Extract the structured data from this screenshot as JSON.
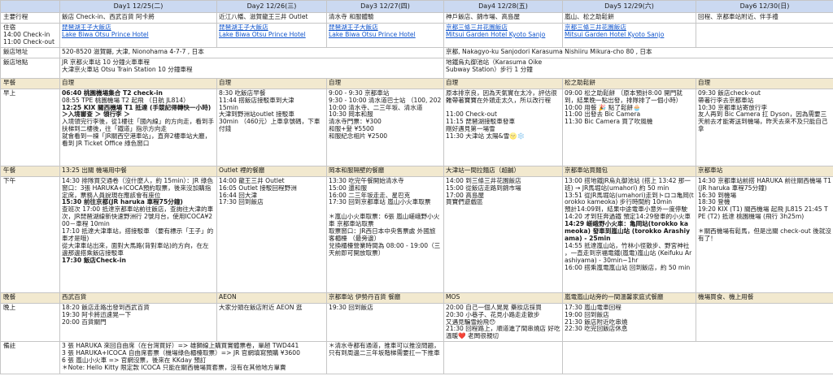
{
  "columns": [
    "Day1 12/25(二)",
    "Day2 12/26(三)",
    "Day3 12/27(四)",
    "Day4 12/28(五)",
    "Day5 12/29(六)",
    "Day6 12/30(日)"
  ],
  "rows": [
    {
      "label": [
        "主要行程"
      ],
      "band": false,
      "cells": [
        [
          {
            "t": "飯店 Check-in、西武百貨 阿卡將"
          }
        ],
        [
          {
            "t": "近江八幡、滋賀龍王三井 Outlet"
          }
        ],
        [
          {
            "t": "清水寺 和服體驗"
          }
        ],
        [
          {
            "t": "神戶飯店、錦市場、高島屋"
          }
        ],
        [
          {
            "t": "嵐山、松之助鬆餅"
          }
        ],
        [
          {
            "t": "回程、京都車站附近、伴手禮"
          }
        ]
      ]
    },
    {
      "label": [
        "住宿",
        "14:00 Check-in",
        "11:00 Check-out"
      ],
      "band": false,
      "cells": [
        [
          {
            "t": "琵琶湖王子大飯店",
            "k": "lnk"
          },
          {
            "t": "Lake Biwa Otsu Prince Hotel",
            "k": "lnk"
          }
        ],
        [
          {
            "t": "琵琶湖王子大飯店",
            "k": "lnk"
          },
          {
            "t": "Lake Biwa Otsu Prince Hotel",
            "k": "lnk"
          }
        ],
        [
          {
            "t": "琵琶湖王子大飯店",
            "k": "lnk"
          },
          {
            "t": "Lake Biwa Otsu Prince Hotel",
            "k": "lnk"
          }
        ],
        [
          {
            "t": "京都三條三井花園飯店",
            "k": "lnk"
          },
          {
            "t": "Mitsui Garden Hotel Kyoto Sanjo",
            "k": "lnk"
          }
        ],
        [
          {
            "t": "京都三條三井花園飯店",
            "k": "lnk"
          },
          {
            "t": "Mitsui Garden Hotel Kyoto Sanjo",
            "k": "lnk"
          }
        ],
        [
          {
            "t": ""
          }
        ]
      ]
    },
    {
      "label": [
        "飯店地址"
      ],
      "band": false,
      "merge": true,
      "cells": [
        [
          {
            "t": "520-8520 滋賀縣, 大津, Nionohama 4-7-7 , 日本"
          }
        ],
        [
          {
            "t": "京都, Nakagyo-ku Sanjodori Karasuma Nishiiru Mikura-cho 80 , 日本"
          }
        ]
      ]
    },
    {
      "label": [
        "飯店地點"
      ],
      "band": false,
      "merge": true,
      "cells": [
        [
          {
            "t": "JR 京都火車站 10 分鐘火車車程"
          },
          {
            "t": "大津京火車站 Otsu Train Station 10 分鐘車程"
          }
        ],
        [
          {
            "t": "地鐵烏丸御池站（Karasuma Oike"
          },
          {
            "t": "Subway Station）步行 1 分鐘"
          }
        ]
      ]
    },
    {
      "label": [
        "早餐"
      ],
      "band": true,
      "cells": [
        [
          {
            "t": "自理"
          }
        ],
        [
          {
            "t": "自理"
          }
        ],
        [
          {
            "t": "自理"
          }
        ],
        [
          {
            "t": "自理"
          }
        ],
        [
          {
            "t": "松之助鬆餅"
          }
        ],
        [
          {
            "t": "自理"
          }
        ]
      ]
    },
    {
      "label": [
        "早上"
      ],
      "band": false,
      "cells": [
        [
          {
            "t": "06:40 桃園機場集合 T2 check-in",
            "k": "b"
          },
          {
            "t": "08:55 TPE 桃園機場 T2 起飛 （日航 JL814）"
          },
          {
            "t": "12:25 KIX 關西機場 T1 抵達 (手競記得轉快一小時) ＞入境審查 ＞ 領行李 ＞",
            "k": "b"
          },
          {
            "t": "入境領完行李後，從1樓往「國內線」的方向走，看到手扶梯到二樓後，往「鐵道」指示方向走"
          },
          {
            "t": "就會看到一棟「JR關西空港車站」，直奔2樓車站大廳，看到 JR Ticket Office 綠色窗口"
          }
        ],
        [
          {
            "t": "8:30 吃飯店早餐"
          },
          {
            "t": "11:44 搭飯店接駁車到大津"
          },
          {
            "t": "15min"
          },
          {
            "t": "大津到野洲站outlet 接駁車"
          },
          {
            "t": "30min （460元）上車拿號碼，下車付錢"
          }
        ],
        [
          {
            "t": "9:00 - 9:30 京都車站"
          },
          {
            "t": "9:30 - 10:00 清水道巴士站 （100, 202"
          },
          {
            "t": "10:00 清水寺、二三年坂、清水道"
          },
          {
            "t": "10:30 岡本和服"
          },
          {
            "t": "清水寺門票：¥300"
          },
          {
            "t": "和服+髮 ¥5500"
          },
          {
            "t": "和服紀念相片 ¥2500"
          }
        ],
        [
          {
            "t": "原本排京良，因為天氣實在太冷，評估很難帶著寶寶在外頭走太久，所以改行程"
          },
          {
            "t": " "
          },
          {
            "t": "11:00 Check-out"
          },
          {
            "t": "11:15 琵琶湖接駁車發車"
          },
          {
            "t": "剛好遇見第一場雪"
          },
          {
            "t": "11:30 大津站 太陽&雪🌝❄️"
          }
        ],
        [
          {
            "t": "09:00 松之助鬆餅 （原本預計8:00 開門就到，結果晚一點出發，排隊排了一個小時）"
          },
          {
            "t": "10:00 用餐 🎉 點了鬆餅🧁"
          },
          {
            "t": "11:00 出發去 Bic Camera"
          },
          {
            "t": "11:30 Bic Camera 買了吹風機"
          }
        ],
        [
          {
            "t": "09:30 飯店check-out"
          },
          {
            "t": "帶著行李去京都車站"
          },
          {
            "t": "10:30 京都車站寄放行李"
          },
          {
            "t": "友人再到 Bic Camera 扛 Dyson，因為需要三天前去才能寄送到機場，昨天去來不及只能自己拿"
          }
        ]
      ]
    },
    {
      "label": [
        "午餐"
      ],
      "band": true,
      "cells": [
        [
          {
            "t": "13:25 出關 機場用中餐"
          }
        ],
        [
          {
            "t": "Outlet 裡的餐廳"
          }
        ],
        [
          {
            "t": "岡本和服隔壁的餐廳"
          }
        ],
        [
          {
            "t": "大津站一間拉麵店（超鹹）"
          }
        ],
        [
          {
            "t": "京都車站買麵包"
          }
        ],
        [
          {
            "t": "京都車站"
          }
        ]
      ]
    },
    {
      "label": [
        "下午"
      ],
      "band": false,
      "cells": [
        [
          {
            "t": "14:30 排隊買交通卷（沒什麼人，約 15min）：JR 綠色窗口：3張 HARUKA+ICOCA預約取票，後來沒加購指定席，票務人員說現在應該會有座位"
          },
          {
            "t": "15:30 前往京都(JR haruka 車程75分鐘)",
            "k": "b"
          },
          {
            "t": "查班次 17:00 抵達京都車站前往飯店，查詢往大津的車次，JR琵琶湖線新快速野洲行 2號月台，使用ICOCA¥200－車程 10min"
          },
          {
            "t": "17:10 抵達大津車站，搭接駁車 （要有標示「王子」的車才是哦)"
          },
          {
            "t": "從大津車站出來，面對大馬路(背對車站)的方向，在左邊那邊搭乘飯店接駁車"
          },
          {
            "t": "17:30 飯店Check-in",
            "k": "b"
          }
        ],
        [
          {
            "t": "14:00 龍王三井 Outlet"
          },
          {
            "t": "16:05 Outlet 接駁回程野洲"
          },
          {
            "t": "16:44 回大津"
          },
          {
            "t": "17:30 回到飯店"
          }
        ],
        [
          {
            "t": "13:30 吃完午餐開始清水寺"
          },
          {
            "t": "15:00 還和服"
          },
          {
            "t": "16:00 二三年坂走走、星巴克"
          },
          {
            "t": "17:30 回到京都車站 嵐山小火車取票"
          },
          {
            "t": " "
          },
          {
            "t": "＊嵐山小火車取票：6張 嵐山嵯峨野小火車 京都車站取票"
          },
          {
            "t": "取票窗口：JR西日本中央售票處 外國旅客櫃檯 （最旁邊）"
          },
          {
            "t": "兌換櫃檯營業時間為 08:00 - 19:00（三天前即可開放取票）"
          }
        ],
        [
          {
            "t": "14:00 到三條三井花園飯店"
          },
          {
            "t": "15:00 從飯店走路到錦市場"
          },
          {
            "t": "17:00 高島屋"
          },
          {
            "t": "買寶們遊戲區"
          }
        ],
        [
          {
            "t": "13:00 搭地鐵JR烏丸御池站 (搭上 13:42 那一班) → JR馬堀站(umahori) 約 50 min"
          },
          {
            "t": "13:51 從JR馬堀站(umahori)走到トロコ亀岡(torokko kameoka) 步行時間約 10min"
          },
          {
            "t": "預計14:09到，結果中途電車小意外一度停駛"
          },
          {
            "t": "14:20 才到狂奔過鐵 預定14:29發車的小火車"
          },
          {
            "t": "14:29 嵯峨野小火車：亀岡站(torokko kameoka) 發車到嵐山站 (torokko Arashiyama) - 25min",
            "k": "b"
          },
          {
            "t": "14:55 抵達嵐山站，竹林小徑散步、野宮神社 ，一直走到京福電鐵(嵐電)嵐山站 (Keifuku Arashiyama) - 30min~1hr"
          },
          {
            "t": "16:00 搭乘嵐電嵐山站 回到飯店，約 50 min"
          }
        ],
        [
          {
            "t": "14:30 京都車站前搭 HARUKA 前往關西機場 T1 (JR haruka 車程75分鐘)"
          },
          {
            "t": "16:30 到機場"
          },
          {
            "t": "18:30 登機"
          },
          {
            "t": "19:20 KIX (T1) 關西機場 起飛 JL815 21:45 TPE (T2) 抵達 桃園機場 (飛行 3h25m)"
          },
          {
            "t": " "
          },
          {
            "t": "＊關西機場有鬆馬，但是出關 check-out 後就沒有了！"
          }
        ]
      ]
    },
    {
      "label": [
        "晚餐"
      ],
      "band": true,
      "cells": [
        [
          {
            "t": "西武百貨"
          }
        ],
        [
          {
            "t": "AEON"
          }
        ],
        [
          {
            "t": "京都車站 伊勢丹百貨 餐廳"
          }
        ],
        [
          {
            "t": "MOS"
          }
        ],
        [
          {
            "t": "嵐電嵐山站旁的一間溫馨家庭式餐廳"
          }
        ],
        [
          {
            "t": "機場買食、機上用餐"
          }
        ]
      ]
    },
    {
      "label": [
        "晚上"
      ],
      "band": false,
      "cells": [
        [
          {
            "t": "18:20 飯店走路出發到西武百貨"
          },
          {
            "t": "19:30 阿卡將迅速晃一下"
          },
          {
            "t": "20:00 百貨關門"
          }
        ],
        [
          {
            "t": "大家分頭在飯店附近 AEON 逛"
          }
        ],
        [
          {
            "t": "19:30 回到飯店"
          }
        ],
        [
          {
            "t": "20:00 自己一個人晃晃 藥妝店採買"
          },
          {
            "t": "20:30 小巷子、花見小路走走散步"
          },
          {
            "t": "又遇見騙雪紛飛😯"
          },
          {
            "t": "21:30 回程路上，順道進了間串燒店 好吃 溫暖❤️ 老闆很親切"
          }
        ],
        [
          {
            "t": "17:30 嵐山電車回程"
          },
          {
            "t": "19:00 回到飯店"
          },
          {
            "t": "21:30 飯店附近吃串燒"
          },
          {
            "t": "22:30 吃完回飯店休息"
          }
        ],
        [
          {
            "t": ""
          }
        ]
      ]
    },
    {
      "label": [
        "備註"
      ],
      "band": false,
      "notes": true,
      "cells": [
        [
          {
            "t": "3 張 HARUKA 來回自由席（在台灣買好）=> 雄獅線上購買實體票卷，單趟 TWD441"
          },
          {
            "t": "3 張 HARUKA+ICOCA 自由席套票（機場綠色櫃檯取票）=> JR 官網填寫預購 ¥3600"
          },
          {
            "t": "6 張 嵐山小火車 => 官網沒票，後來在 KKday 預訂"
          },
          {
            "t": "＊Note: Hello Kitty 限定款 ICOCA 只能在關西機場買套票，沒有在其他地方單賣"
          }
        ],
        [
          {
            "t": "＊清水寺都有通道，推車可以推沒問題，只有到周邊二三年坂階梯需要扛一下推車"
          }
        ],
        [
          {
            "t": ""
          }
        ],
        [
          {
            "t": ""
          }
        ]
      ]
    }
  ]
}
